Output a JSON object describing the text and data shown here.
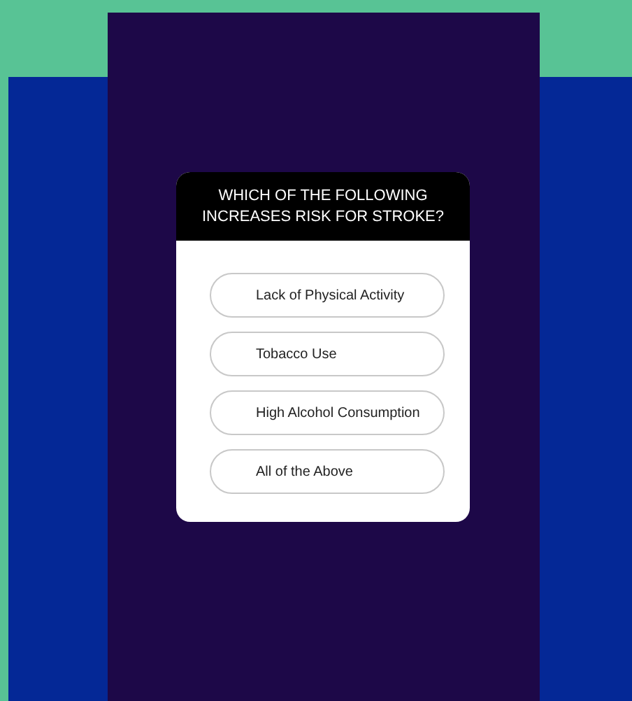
{
  "quiz": {
    "question": "WHICH OF THE FOLLOWING INCREASES RISK FOR STROKE?",
    "options": [
      {
        "label": "Lack of Physical Activity"
      },
      {
        "label": "Tobacco Use"
      },
      {
        "label": "High Alcohol Consumption"
      },
      {
        "label": "All of the Above"
      }
    ]
  }
}
